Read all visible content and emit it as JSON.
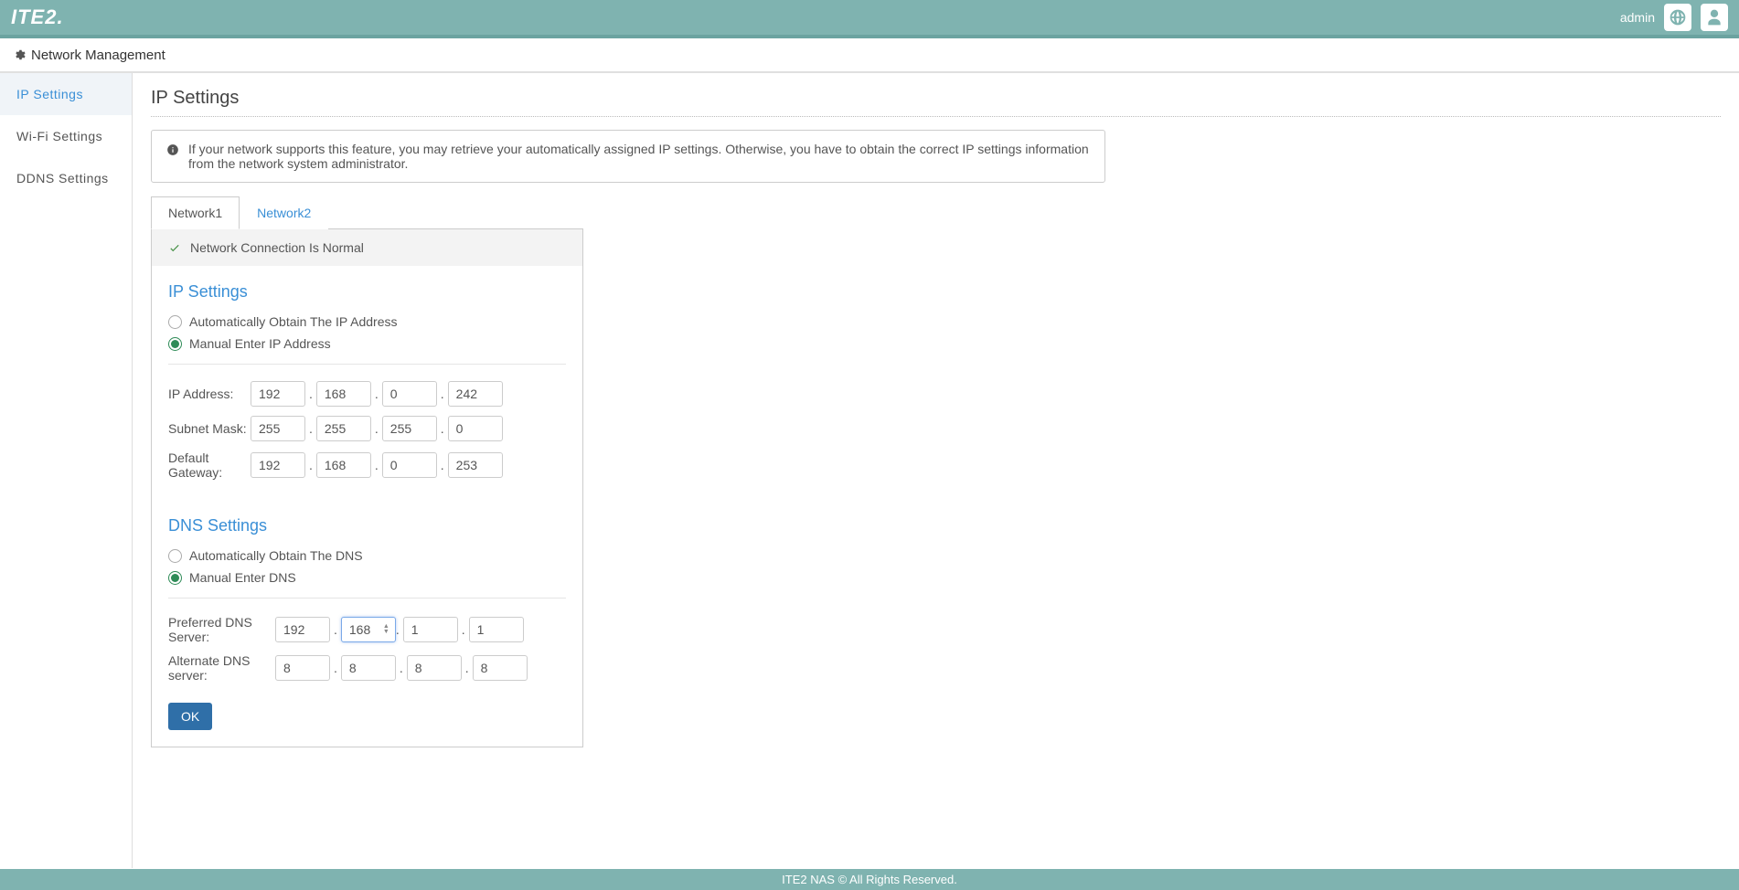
{
  "topbar": {
    "logo": "ITE2.",
    "user": "admin"
  },
  "breadcrumb": "Network Management",
  "sidebar": {
    "items": [
      {
        "label": "IP Settings",
        "active": true
      },
      {
        "label": "Wi-Fi Settings",
        "active": false
      },
      {
        "label": "DDNS Settings",
        "active": false
      }
    ]
  },
  "page": {
    "title": "IP Settings",
    "info": "If your network supports this feature, you may retrieve your automatically assigned IP settings. Otherwise, you have to obtain the correct IP settings information from the network system administrator."
  },
  "tabs": [
    {
      "label": "Network1",
      "active": true
    },
    {
      "label": "Network2",
      "active": false
    }
  ],
  "status": "Network Connection Is Normal",
  "ip_section": {
    "title": "IP Settings",
    "radio_auto": "Automatically Obtain The IP Address",
    "radio_manual": "Manual Enter IP Address",
    "selected": "manual",
    "fields": {
      "ip_label": "IP Address:",
      "ip": [
        "192",
        "168",
        "0",
        "242"
      ],
      "mask_label": "Subnet Mask:",
      "mask": [
        "255",
        "255",
        "255",
        "0"
      ],
      "gw_label": "Default Gateway:",
      "gw": [
        "192",
        "168",
        "0",
        "253"
      ]
    }
  },
  "dns_section": {
    "title": "DNS Settings",
    "radio_auto": "Automatically Obtain The DNS",
    "radio_manual": "Manual Enter DNS",
    "selected": "manual",
    "fields": {
      "pref_label": "Preferred DNS Server:",
      "pref": [
        "192",
        "168",
        "1",
        "1"
      ],
      "alt_label": "Alternate DNS server:",
      "alt": [
        "8",
        "8",
        "8",
        "8"
      ]
    }
  },
  "buttons": {
    "ok": "OK"
  },
  "footer": "ITE2 NAS © All Rights Reserved."
}
